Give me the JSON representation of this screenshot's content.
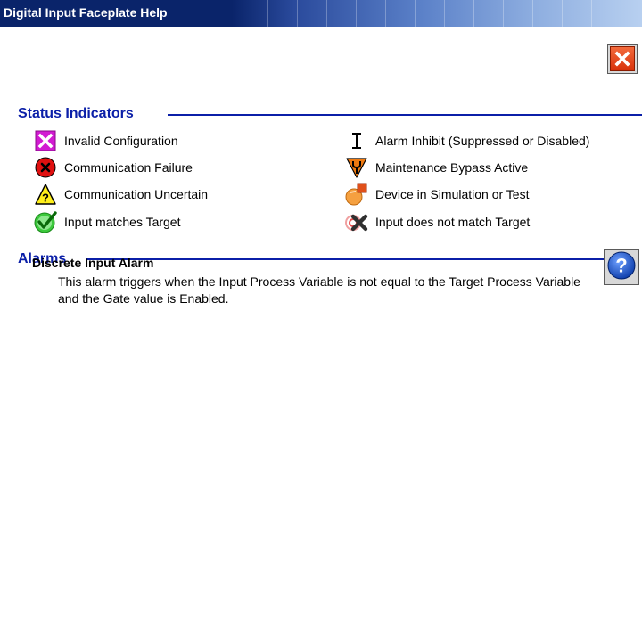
{
  "window": {
    "title": "Digital Input Faceplate Help",
    "close_icon": "close-icon",
    "help_icon": "help-icon"
  },
  "status_indicators": {
    "heading": "Status Indicators",
    "items": [
      {
        "label": "Invalid Configuration",
        "icon": "invalid-configuration-icon"
      },
      {
        "label": "Communication Failure",
        "icon": "communication-failure-icon"
      },
      {
        "label": "Communication Uncertain",
        "icon": "communication-uncertain-icon"
      },
      {
        "label": "Input matches Target",
        "icon": "input-matches-target-icon"
      },
      {
        "label": "Alarm Inhibit (Suppressed or Disabled)",
        "icon": "alarm-inhibit-icon"
      },
      {
        "label": "Maintenance Bypass Active",
        "icon": "maintenance-bypass-icon"
      },
      {
        "label": "Device in Simulation or Test",
        "icon": "simulation-test-icon"
      },
      {
        "label": "Input does not match Target",
        "icon": "input-mismatch-target-icon"
      }
    ]
  },
  "alarms": {
    "heading": "Alarms",
    "items": [
      {
        "name": "Discrete Input Alarm",
        "description": "This alarm triggers when the Input Process Variable is not equal to the Target Process Variable and the Gate value is Enabled."
      }
    ]
  },
  "colors": {
    "title_bar": "#0a246a",
    "section_heading": "#0b1fa8",
    "close_button": "#e8481c",
    "help_button": "#1a4fc4"
  }
}
